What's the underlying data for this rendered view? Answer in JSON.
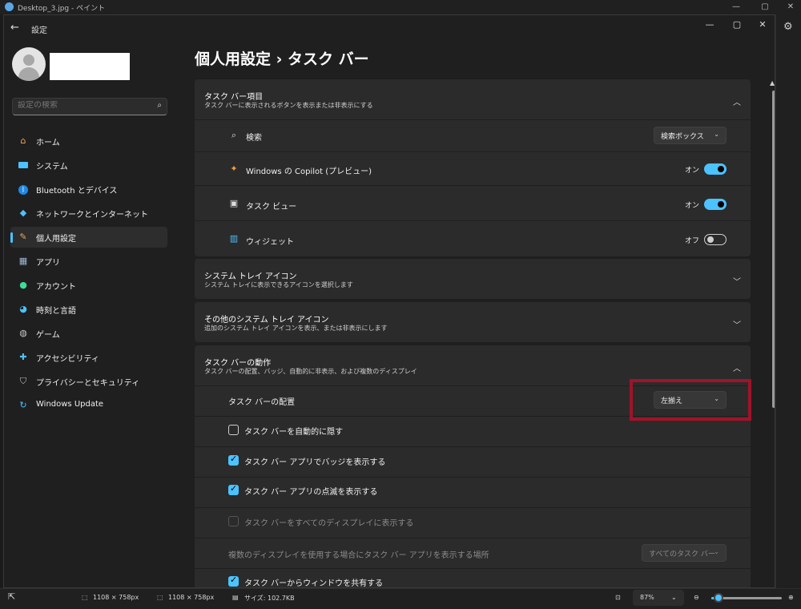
{
  "paint": {
    "title": "Desktop_3.jpg - ペイント",
    "status": {
      "selection_size": "1108 × 758px",
      "image_size": "1108 × 758px",
      "file_size": "サイズ: 102.7KB",
      "zoom": "87%",
      "zoom_level": 0.1
    }
  },
  "settings": {
    "app_title": "設定",
    "search_placeholder": "設定の検索",
    "nav": [
      {
        "label": "ホーム",
        "icon": "home-icon",
        "selected": false
      },
      {
        "label": "システム",
        "icon": "system-icon",
        "selected": false
      },
      {
        "label": "Bluetooth とデバイス",
        "icon": "bluetooth-icon",
        "selected": false
      },
      {
        "label": "ネットワークとインターネット",
        "icon": "network-icon",
        "selected": false
      },
      {
        "label": "個人用設定",
        "icon": "brush-icon",
        "selected": true
      },
      {
        "label": "アプリ",
        "icon": "apps-icon",
        "selected": false
      },
      {
        "label": "アカウント",
        "icon": "account-icon",
        "selected": false
      },
      {
        "label": "時刻と言語",
        "icon": "globe-clock-icon",
        "selected": false
      },
      {
        "label": "ゲーム",
        "icon": "gamepad-icon",
        "selected": false
      },
      {
        "label": "アクセシビリティ",
        "icon": "accessibility-icon",
        "selected": false
      },
      {
        "label": "プライバシーとセキュリティ",
        "icon": "shield-icon",
        "selected": false
      },
      {
        "label": "Windows Update",
        "icon": "update-icon",
        "selected": false
      }
    ],
    "page_title": "個人用設定  ›  タスク バー",
    "taskbar_items": {
      "title": "タスク バー項目",
      "subtitle": "タスク バーに表示されるボタンを表示または非表示にする",
      "search": {
        "label": "検索",
        "value": "検索ボックス"
      },
      "copilot": {
        "label": "Windows の Copilot (プレビュー)",
        "state": "オン"
      },
      "taskview": {
        "label": "タスク ビュー",
        "state": "オン"
      },
      "widgets": {
        "label": "ウィジェット",
        "state": "オフ"
      }
    },
    "system_tray": {
      "title": "システム トレイ アイコン",
      "subtitle": "システム トレイに表示できるアイコンを選択します"
    },
    "other_tray": {
      "title": "その他のシステム トレイ アイコン",
      "subtitle": "追加のシステム トレイ アイコンを表示、または非表示にします"
    },
    "behaviors": {
      "title": "タスク バーの動作",
      "subtitle": "タスク バーの配置、バッジ、自動的に非表示、および複数のディスプレイ",
      "alignment": {
        "label": "タスク バーの配置",
        "value": "左揃え"
      },
      "auto_hide": "タスク バーを自動的に隠す",
      "badges": "タスク バー アプリでバッジを表示する",
      "flashing": "タスク バー アプリの点滅を表示する",
      "all_displays": "タスク バーをすべてのディスプレイに表示する",
      "multi_display": {
        "label": "複数のディスプレイを使用する場合にタスク バー アプリを表示する場所",
        "value": "すべてのタスク バー"
      },
      "share_window": "タスク バーからウィンドウを共有する"
    }
  }
}
